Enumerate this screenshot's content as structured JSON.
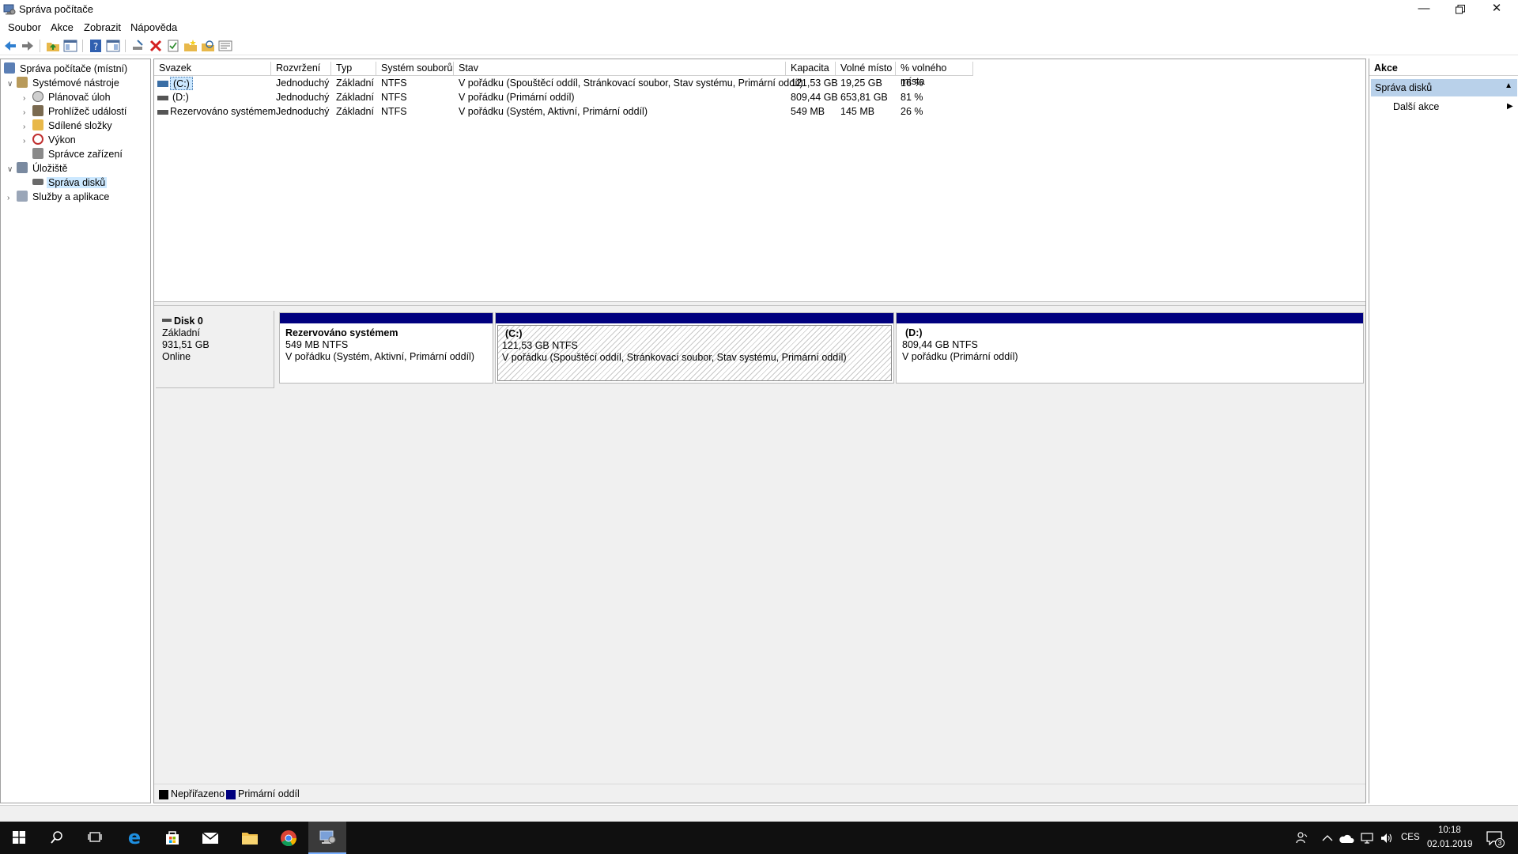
{
  "window": {
    "title": "Správa počítače"
  },
  "menu": [
    "Soubor",
    "Akce",
    "Zobrazit",
    "Nápověda"
  ],
  "tree": {
    "root": "Správa počítače (místní)",
    "system_tools": "Systémové nástroje",
    "task_scheduler": "Plánovač úloh",
    "event_viewer": "Prohlížeč událostí",
    "shared_folders": "Sdílené složky",
    "performance": "Výkon",
    "device_manager": "Správce zařízení",
    "storage": "Úložiště",
    "disk_management": "Správa disků",
    "services": "Služby a aplikace"
  },
  "volumes": {
    "columns": [
      "Svazek",
      "Rozvržení",
      "Typ",
      "Systém souborů",
      "Stav",
      "Kapacita",
      "Volné místo",
      "% volného místa"
    ],
    "rows": [
      [
        "(C:)",
        "Jednoduchý",
        "Základní",
        "NTFS",
        "V pořádku (Spouštěcí oddíl, Stránkovací soubor, Stav systému, Primární oddíl)",
        "121,53 GB",
        "19,25 GB",
        "16 %"
      ],
      [
        "(D:)",
        "Jednoduchý",
        "Základní",
        "NTFS",
        "V pořádku (Primární oddíl)",
        "809,44 GB",
        "653,81 GB",
        "81 %"
      ],
      [
        "Rezervováno systémem",
        "Jednoduchý",
        "Základní",
        "NTFS",
        "V pořádku (Systém, Aktivní, Primární oddíl)",
        "549 MB",
        "145 MB",
        "26 %"
      ]
    ]
  },
  "disk": {
    "name": "Disk 0",
    "type": "Základní",
    "size": "931,51 GB",
    "status": "Online",
    "partitions": [
      {
        "name": "Rezervováno systémem",
        "size": "549 MB NTFS",
        "status": "V pořádku (Systém, Aktivní, Primární oddíl)"
      },
      {
        "name": "(C:)",
        "size": "121,53 GB NTFS",
        "status": "V pořádku (Spouštěcí oddíl, Stránkovací soubor, Stav systému, Primární oddíl)"
      },
      {
        "name": "(D:)",
        "size": "809,44 GB NTFS",
        "status": "V pořádku (Primární oddíl)"
      }
    ]
  },
  "legend": {
    "unallocated": "Nepřiřazeno",
    "primary": "Primární oddíl"
  },
  "actions": {
    "header": "Akce",
    "section": "Správa disků",
    "more": "Další akce"
  },
  "taskbar": {
    "lang": "CES",
    "time": "10:18",
    "date": "02.01.2019",
    "notifications": "3"
  },
  "colors": {
    "primary_partition": "#00007f",
    "selection": "#cce8ff",
    "action_header": "#b9d1ea"
  }
}
